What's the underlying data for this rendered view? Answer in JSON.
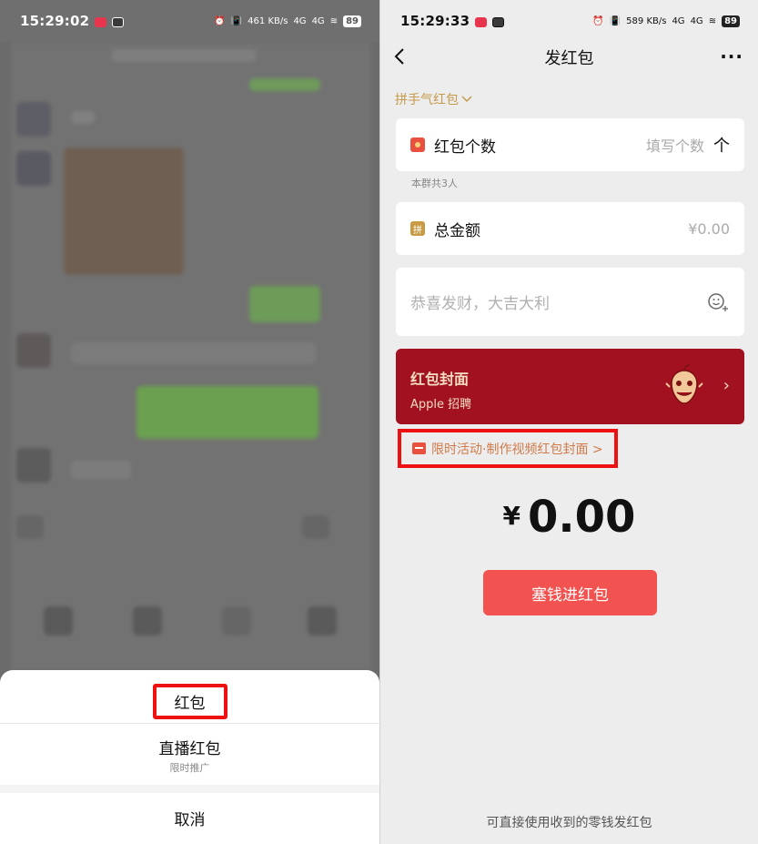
{
  "left": {
    "status_bar": {
      "time": "15:29:02",
      "net_speed": "461 KB/s",
      "signal_4g_1": "4G",
      "signal_4g_2": "4G",
      "battery": "89"
    },
    "sheet": {
      "option_red_packet": "红包",
      "option_live_red_packet": "直播红包",
      "option_live_sub": "限时推广",
      "cancel": "取消"
    }
  },
  "right": {
    "status_bar": {
      "time": "15:29:33",
      "net_speed": "589 KB/s",
      "signal_4g_1": "4G",
      "signal_4g_2": "4G",
      "battery": "89"
    },
    "nav": {
      "title": "发红包",
      "more": "···"
    },
    "type_selector": "拼手气红包",
    "count_card": {
      "label": "红包个数",
      "placeholder": "填写个数",
      "arrow": "个"
    },
    "group_hint": "本群共3人",
    "amount_card": {
      "icon_text": "拼",
      "label": "总金额",
      "value": "¥0.00"
    },
    "wish_placeholder": "恭喜发财，大吉大利",
    "cover": {
      "title": "红包封面",
      "subtitle": "Apple 招聘"
    },
    "promo": "限时活动·制作视频红包封面 >",
    "amount_display": {
      "currency": "¥",
      "value": "0.00"
    },
    "send_button": "塞钱进红包",
    "footer_note": "可直接使用收到的零钱发红包"
  },
  "colors": {
    "accent_gold": "#c69a4b",
    "cover_red": "#a11120",
    "button_red": "#f25350",
    "highlight_red": "#ee1111"
  },
  "icons": [
    "back-arrow-icon",
    "more-icon",
    "chevron-down-icon",
    "red-packet-icon",
    "pin-icon",
    "emoji-add-icon",
    "cover-art-icon",
    "chevron-right-icon",
    "promo-icon"
  ]
}
